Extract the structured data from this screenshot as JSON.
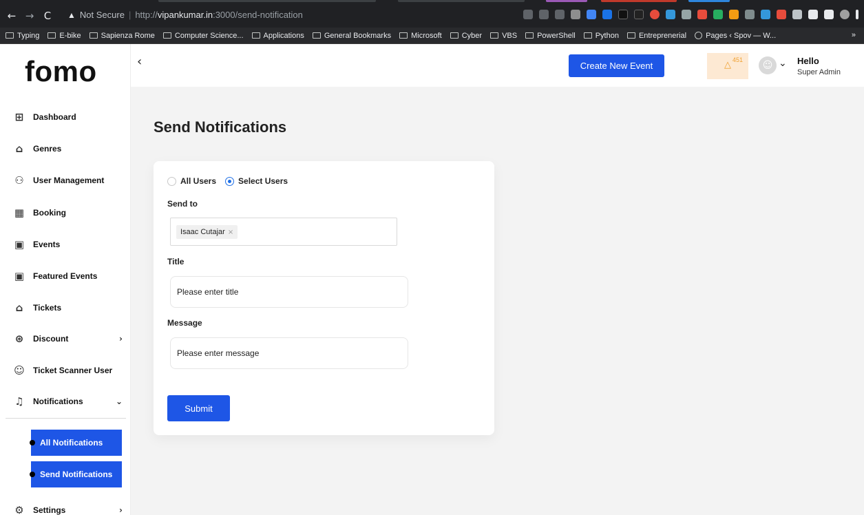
{
  "browser": {
    "not_secure_label": "Not Secure",
    "url_scheme": "http://",
    "url_host": "vipankumar.in",
    "url_path": ":3000/send-notification",
    "bookmarks": [
      "Typing",
      "E-bike",
      "Sapienza Rome",
      "Computer Science...",
      "Applications",
      "General Bookmarks",
      "Microsoft",
      "Cyber",
      "VBS",
      "PowerShell",
      "Python",
      "Entreprenerial"
    ],
    "bookmark_pages": "Pages ‹ Spov — W...",
    "more": "»"
  },
  "app": {
    "logo": "fomo",
    "sidebar": {
      "items": [
        {
          "label": "Dashboard",
          "icon": "dashboard-icon"
        },
        {
          "label": "Genres",
          "icon": "genres-icon"
        },
        {
          "label": "User Management",
          "icon": "users-icon"
        },
        {
          "label": "Booking",
          "icon": "calendar-icon"
        },
        {
          "label": "Events",
          "icon": "event-icon"
        },
        {
          "label": "Featured Events",
          "icon": "featured-event-icon"
        },
        {
          "label": "Tickets",
          "icon": "ticket-icon"
        },
        {
          "label": "Discount",
          "icon": "discount-icon"
        },
        {
          "label": "Ticket Scanner User",
          "icon": "scanner-user-icon"
        },
        {
          "label": "Notifications",
          "icon": "bell-icon"
        }
      ],
      "sub_items": [
        "All Notifications",
        "Send Notifications"
      ],
      "settings": "Settings"
    },
    "header": {
      "create_button": "Create New Event",
      "notification_count": "451",
      "greeting": "Hello",
      "role": "Super Admin"
    },
    "page": {
      "title": "Send Notifications",
      "radio_all": "All Users",
      "radio_select": "Select Users",
      "selected_radio": "Select Users",
      "send_to_label": "Send to",
      "selected_user": "Isaac Cutajar",
      "title_label": "Title",
      "title_placeholder": "Please enter title",
      "message_label": "Message",
      "message_placeholder": "Please enter message",
      "submit": "Submit"
    }
  },
  "colors": {
    "primary": "#1e56e6",
    "bell": "#f0a030",
    "bell_bg": "#fde9d3"
  }
}
